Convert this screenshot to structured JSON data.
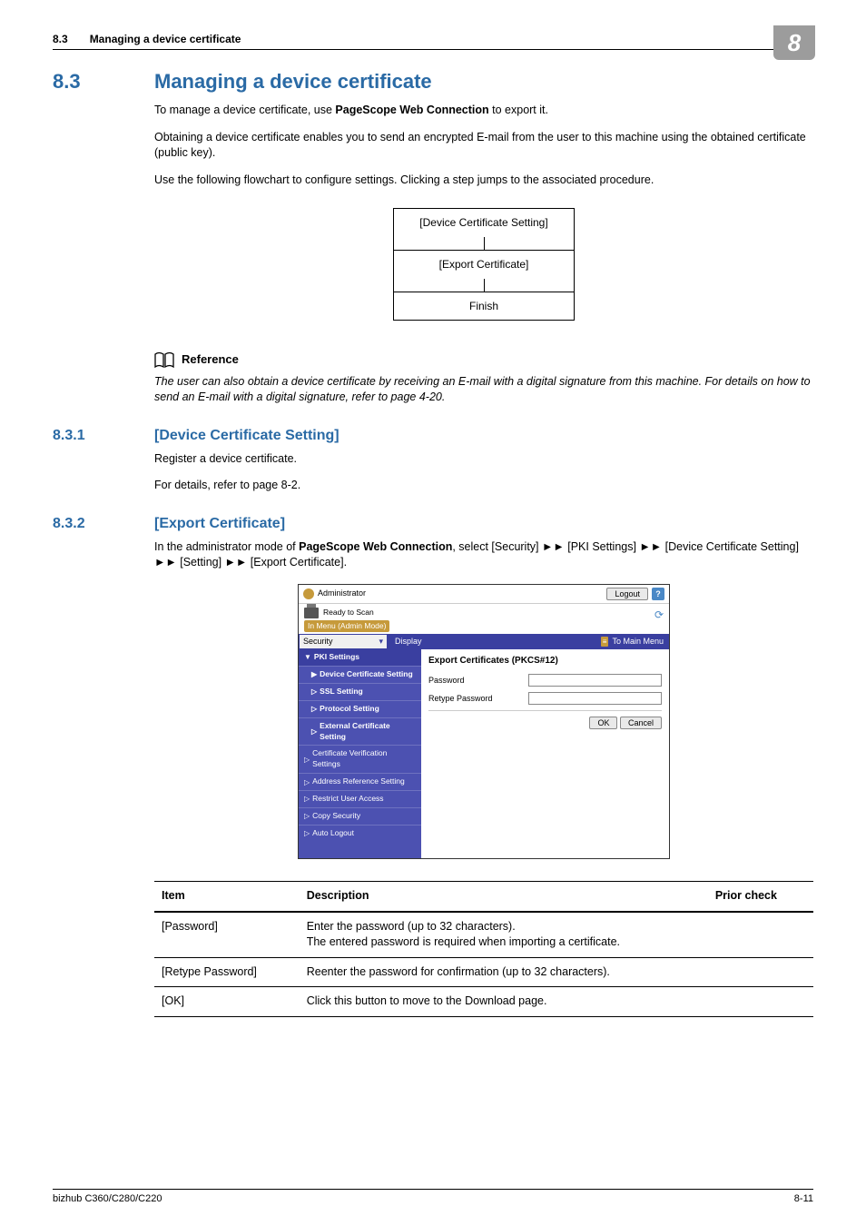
{
  "runhead": {
    "secnum": "8.3",
    "title": "Managing a device certificate"
  },
  "chapter_num": "8",
  "section": {
    "num": "8.3",
    "title": "Managing a device certificate",
    "p1_a": "To manage a device certificate, use ",
    "p1_b": "PageScope Web Connection",
    "p1_c": " to export it.",
    "p2": "Obtaining a device certificate enables you to send an encrypted E-mail from the user to this machine using the obtained certificate (public key).",
    "p3": "Use the following flowchart to configure settings. Clicking a step jumps to the associated procedure."
  },
  "flowchart": {
    "step1": "[Device Certificate Setting]",
    "step2": "[Export Certificate]",
    "step3": "Finish"
  },
  "reference": {
    "label": "Reference",
    "text": "The user can also obtain a device certificate by receiving an E-mail with a digital signature from this machine. For details on how to send an E-mail with a digital signature, refer to page 4-20."
  },
  "sub1": {
    "num": "8.3.1",
    "title": "[Device Certificate Setting]",
    "p1": "Register a device certificate.",
    "p2": "For details, refer to page 8-2."
  },
  "sub2": {
    "num": "8.3.2",
    "title": "[Export Certificate]",
    "intro_a": "In the administrator mode of ",
    "intro_b": "PageScope Web Connection",
    "intro_c": ", select [Security] ►► [PKI Settings] ►► [Device Certificate Setting] ►► [Setting] ►► [Export Certificate]."
  },
  "screenshot": {
    "admin": "Administrator",
    "logout": "Logout",
    "help": "?",
    "ready": "Ready to Scan",
    "mode": "In Menu (Admin Mode)",
    "dropdown": "Security",
    "display": "Display",
    "tomain": "To Main Menu",
    "side": {
      "pki": "PKI Settings",
      "dev": "Device Certificate Setting",
      "ssl": "SSL Setting",
      "proto": "Protocol Setting",
      "ext": "External Certificate Setting",
      "cert": "Certificate Verification Settings",
      "addr": "Address Reference Setting",
      "restrict": "Restrict User Access",
      "copy": "Copy Security",
      "auto": "Auto Logout"
    },
    "panel_title": "Export Certificates (PKCS#12)",
    "pw_label": "Password",
    "rpw_label": "Retype Password",
    "ok": "OK",
    "cancel": "Cancel"
  },
  "table": {
    "headers": {
      "item": "Item",
      "desc": "Description",
      "prior": "Prior check"
    },
    "rows": [
      {
        "item": "[Password]",
        "desc": "Enter the password (up to 32 characters).\nThe entered password is required when importing a certificate.",
        "prior": ""
      },
      {
        "item": "[Retype Password]",
        "desc": "Reenter the password for confirmation (up to 32 characters).",
        "prior": ""
      },
      {
        "item": "[OK]",
        "desc": "Click this button to move to the Download page.",
        "prior": ""
      }
    ]
  },
  "footer": {
    "left": "bizhub C360/C280/C220",
    "right": "8-11"
  }
}
